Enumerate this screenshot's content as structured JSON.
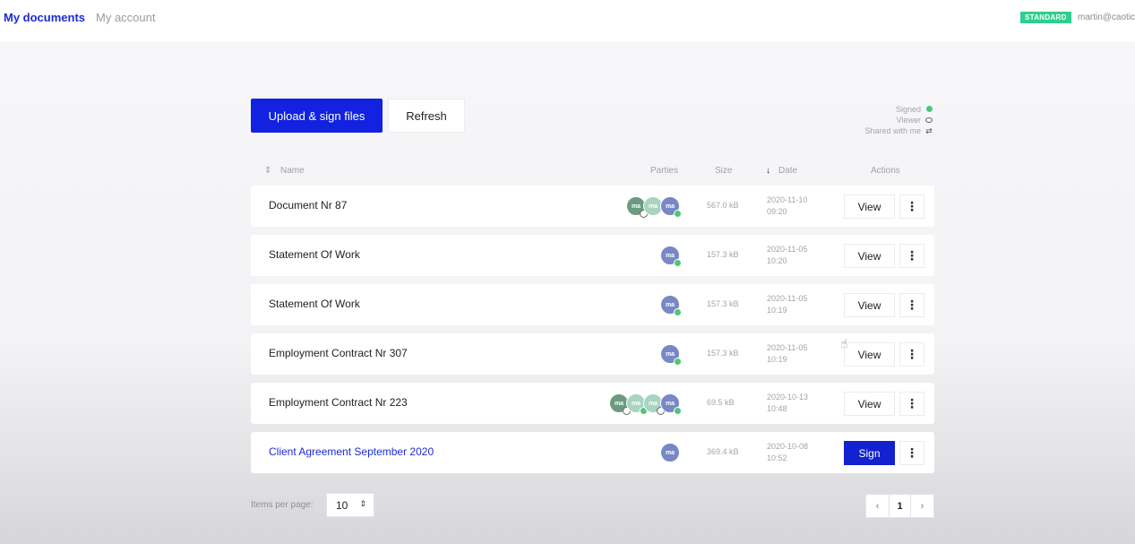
{
  "nav": {
    "tabs": [
      {
        "label": "My documents",
        "active": true
      },
      {
        "label": "My account",
        "active": false
      }
    ],
    "plan_badge": "STANDARD",
    "user_email": "martin@caotic"
  },
  "toolbar": {
    "upload_label": "Upload & sign files",
    "refresh_label": "Refresh"
  },
  "legend": {
    "signed": "Signed",
    "viewer": "Viewer",
    "shared": "Shared with me"
  },
  "table": {
    "headers": {
      "name": "Name",
      "parties": "Parties",
      "size": "Size",
      "date": "Date",
      "actions": "Actions"
    },
    "rows": [
      {
        "name": "Document Nr 87",
        "size": "567.0 kB",
        "date": "2020-11-10",
        "time": "09:20",
        "action": "View"
      },
      {
        "name": "Statement Of Work",
        "size": "157.3 kB",
        "date": "2020-11-05",
        "time": "10:20",
        "action": "View"
      },
      {
        "name": "Statement Of Work",
        "size": "157.3 kB",
        "date": "2020-11-05",
        "time": "10:19",
        "action": "View"
      },
      {
        "name": "Employment Contract Nr 307",
        "size": "157.3 kB",
        "date": "2020-11-05",
        "time": "10:19",
        "action": "View"
      },
      {
        "name": "Employment Contract Nr 223",
        "size": "69.5 kB",
        "date": "2020-10-13",
        "time": "10:48",
        "action": "View"
      },
      {
        "name": "Client Agreement September 2020",
        "size": "369.4 kB",
        "date": "2020-10-08",
        "time": "10:52",
        "action": "Sign"
      }
    ],
    "avatar_initials": "ma"
  },
  "pagination": {
    "items_per_page_label": "Items per page:",
    "items_per_page": "10",
    "current_page": "1"
  },
  "colors": {
    "accent": "#1222e0",
    "badge": "#2fcf8e",
    "signed": "#4cc777"
  }
}
